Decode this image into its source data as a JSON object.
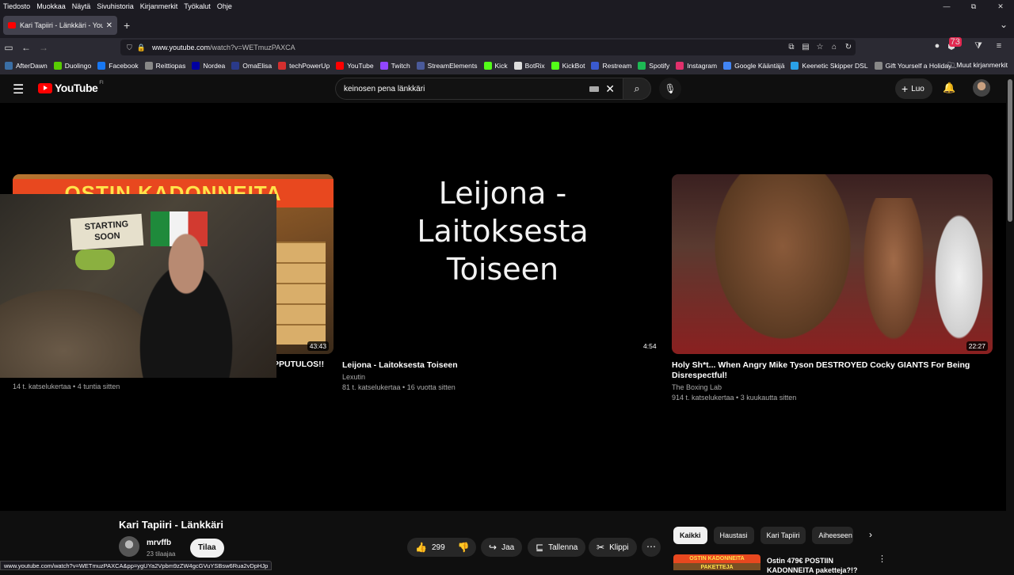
{
  "menubar": {
    "items": [
      "Tiedosto",
      "Muokkaa",
      "Näytä",
      "Sivuhistoria",
      "Kirjanmerkit",
      "Työkalut",
      "Ohje"
    ]
  },
  "window_controls": {
    "minimize": "—",
    "restore": "⧉",
    "close": "✕"
  },
  "tab": {
    "title": "Kari Tapiiri - Länkkäri - YouTube",
    "close": "✕",
    "new_tab": "+"
  },
  "nav": {
    "url_host": "www.youtube.com",
    "url_path": "/watch?v=WETmuzPAXCA",
    "notification_badge": "73"
  },
  "bookmarks": {
    "items": [
      {
        "label": "AfterDawn",
        "color": "#3a6ea5"
      },
      {
        "label": "Duolingo",
        "color": "#58cc02"
      },
      {
        "label": "Facebook",
        "color": "#1877f2"
      },
      {
        "label": "Reittiopas",
        "color": "#888888"
      },
      {
        "label": "Nordea",
        "color": "#0000a0"
      },
      {
        "label": "OmaElisa",
        "color": "#2a3a8a"
      },
      {
        "label": "techPowerUp",
        "color": "#d32f2f"
      },
      {
        "label": "YouTube",
        "color": "#ff0000"
      },
      {
        "label": "Twitch",
        "color": "#9146ff"
      },
      {
        "label": "StreamElements",
        "color": "#4a5a9a"
      },
      {
        "label": "Kick",
        "color": "#53fc18"
      },
      {
        "label": "BotRix",
        "color": "#dddddd"
      },
      {
        "label": "KickBot",
        "color": "#53fc18"
      },
      {
        "label": "Restream",
        "color": "#3a5acf"
      },
      {
        "label": "Spotify",
        "color": "#1db954"
      },
      {
        "label": "Instagram",
        "color": "#e1306c"
      },
      {
        "label": "Google Kääntäjä",
        "color": "#4285f4"
      },
      {
        "label": "Keenetic Skipper DSL",
        "color": "#2aa1e8"
      },
      {
        "label": "Gift Yourself a Holiday...",
        "color": "#888888"
      }
    ],
    "other": "Muut kirjanmerkit"
  },
  "youtube": {
    "logo_text": "YouTube",
    "country_code": "FI",
    "search_value": "keinosen pena länkkäri",
    "create_label": "Luo"
  },
  "endscreen": {
    "cards": [
      {
        "thumb_banner": "OSTIN KADONNEITA PAKETTEJA!",
        "duration": "43:43",
        "title_visible": "PPUTULOS!!",
        "meta": "14 t. katselukertaa • 4 tuntia sitten"
      },
      {
        "thumb_lines": [
          "Leijona -",
          "Laitoksesta",
          "Toiseen"
        ],
        "duration": "4:54",
        "title": "Leijona - Laitoksesta Toiseen",
        "channel": "Lexutin",
        "meta": "81 t. katselukertaa • 16 vuotta sitten"
      },
      {
        "duration": "22:27",
        "title": "Holy Sh*t... When Angry Mike Tyson DESTROYED Cocky GIANTS For Being Disrespectful!",
        "channel": "The Boxing Lab",
        "meta": "914 t. katselukertaa • 3 kuukautta sitten"
      }
    ],
    "webcam_sign": "STARTING SOON"
  },
  "video": {
    "title": "Kari Tapiiri - Länkkäri",
    "channel": "mrvffb",
    "subscribers": "23 tilaajaa",
    "subscribe_label": "Tilaa",
    "likes": "299",
    "share_label": "Jaa",
    "save_label": "Tallenna",
    "clip_label": "Klippi"
  },
  "chips": [
    "Kaikki",
    "Haustasi",
    "Kari Tapiiri",
    "Aiheeseen liittyvät"
  ],
  "recommendation": {
    "thumb_text": "OSTIN KADONNEITA PAKETTEJA",
    "title": "Ostin 479€ POSTIIN KADONNEITA paketteja?!?"
  },
  "status_url": "www.youtube.com/watch?v=WETmuzPAXCA&pp=ygUYa2Vpbm9zZW4gcGVuYSBsw6Rua2vDpHJp"
}
